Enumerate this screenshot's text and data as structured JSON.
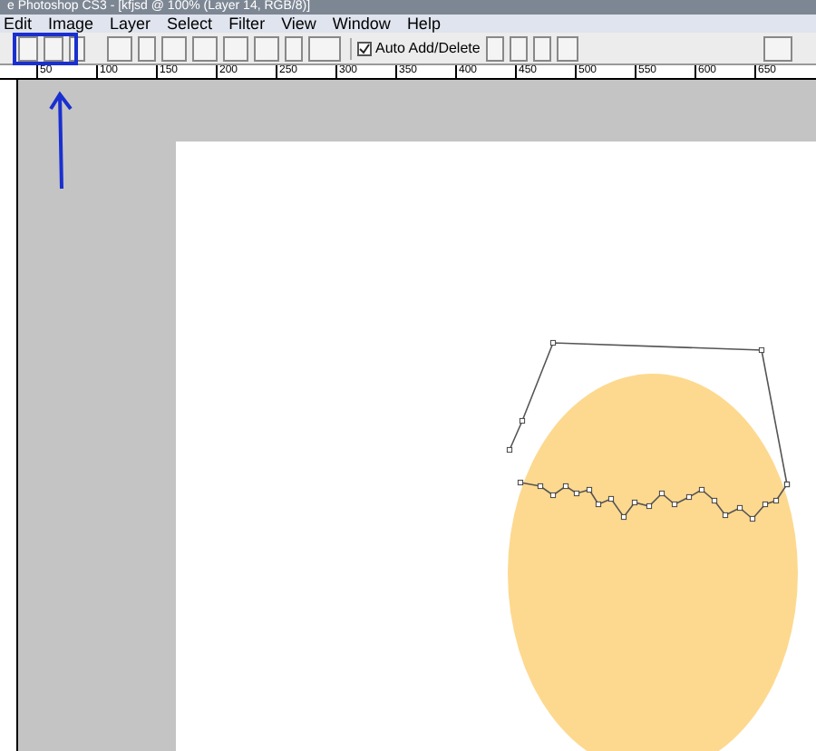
{
  "window": {
    "title": "e Photoshop CS3 - [kfjsd @ 100% (Layer 14, RGB/8)]"
  },
  "menu": [
    "Edit",
    "Image",
    "Layer",
    "Select",
    "Filter",
    "View",
    "Window",
    "Help"
  ],
  "options_bar": {
    "auto_add_delete": {
      "label": "Auto Add/Delete",
      "checked": true
    }
  },
  "ruler": [
    "50",
    "100",
    "150",
    "200",
    "250",
    "300",
    "350",
    "400",
    "450",
    "500",
    "550",
    "600",
    "650"
  ]
}
